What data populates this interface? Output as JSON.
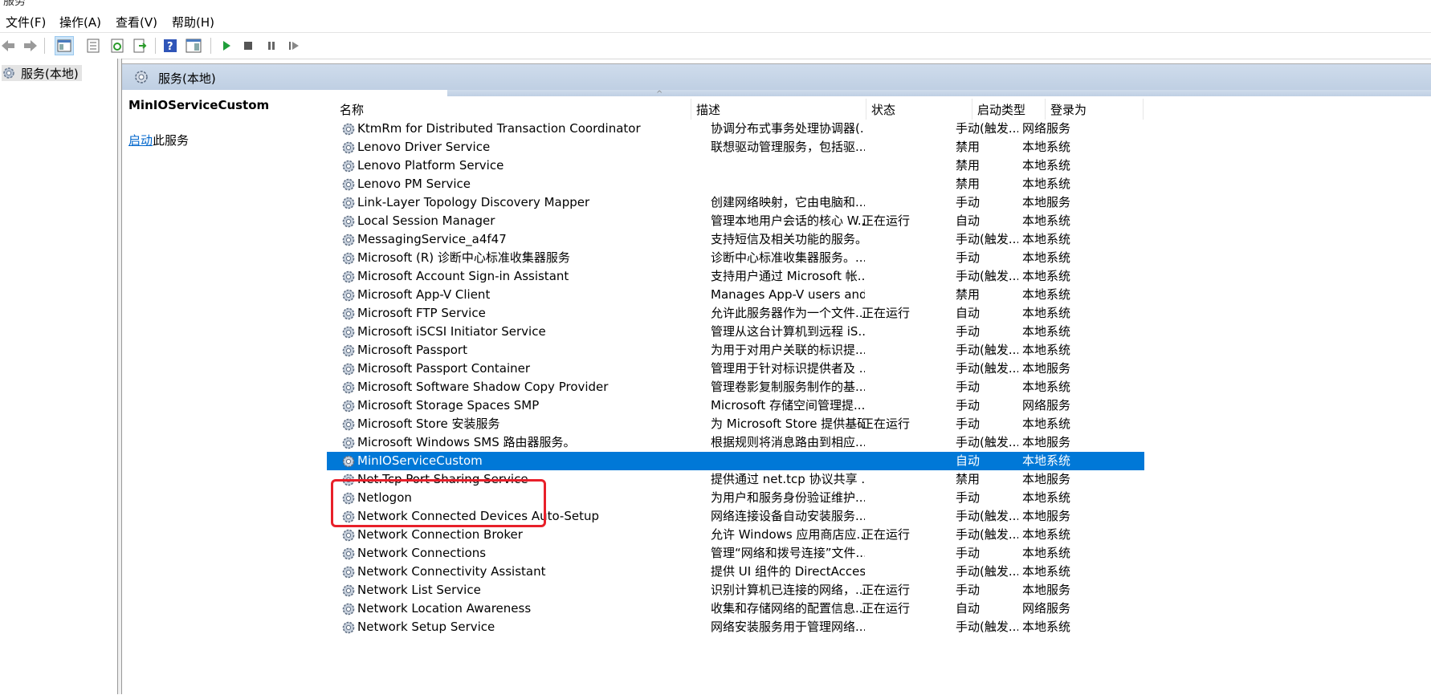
{
  "window": {
    "title": "服务"
  },
  "menu": [
    "文件(F)",
    "操作(A)",
    "查看(V)",
    "帮助(H)"
  ],
  "toolbar": [
    {
      "name": "back-icon"
    },
    {
      "name": "forward-icon"
    },
    {
      "name": "show-hide-tree-icon"
    },
    {
      "name": "properties-icon"
    },
    {
      "name": "refresh-icon"
    },
    {
      "name": "export-list-icon"
    },
    {
      "name": "help-icon"
    },
    {
      "name": "show-hide-action-pane-icon"
    },
    {
      "name": "start-service-icon"
    },
    {
      "name": "stop-service-icon"
    },
    {
      "name": "pause-service-icon"
    },
    {
      "name": "restart-service-icon"
    }
  ],
  "tree": {
    "root_label": "服务(本地)"
  },
  "pane": {
    "header": "服务(本地)"
  },
  "description_pane": {
    "service_name": "MinIOServiceCustom",
    "action_link": "启动",
    "action_suffix": "此服务"
  },
  "columns": {
    "name": "名称",
    "description": "描述",
    "status": "状态",
    "startup_type": "启动类型",
    "logon_as": "登录为"
  },
  "services": [
    {
      "name": "KtmRm for Distributed Transaction Coordinator",
      "description": "协调分布式事务处理协调器(...",
      "status": "",
      "startup": "手动(触发...",
      "logon": "网络服务"
    },
    {
      "name": "Lenovo Driver Service",
      "description": "联想驱动管理服务，包括驱...",
      "status": "",
      "startup": "禁用",
      "logon": "本地系统"
    },
    {
      "name": "Lenovo Platform Service",
      "description": "",
      "status": "",
      "startup": "禁用",
      "logon": "本地系统"
    },
    {
      "name": "Lenovo PM Service",
      "description": "",
      "status": "",
      "startup": "禁用",
      "logon": "本地系统"
    },
    {
      "name": "Link-Layer Topology Discovery Mapper",
      "description": "创建网络映射，它由电脑和...",
      "status": "",
      "startup": "手动",
      "logon": "本地服务"
    },
    {
      "name": "Local Session Manager",
      "description": "管理本地用户会话的核心 W...",
      "status": "正在运行",
      "startup": "自动",
      "logon": "本地系统"
    },
    {
      "name": "MessagingService_a4f47",
      "description": "支持短信及相关功能的服务。",
      "status": "",
      "startup": "手动(触发...",
      "logon": "本地系统"
    },
    {
      "name": "Microsoft (R) 诊断中心标准收集器服务",
      "description": "诊断中心标准收集器服务。...",
      "status": "",
      "startup": "手动",
      "logon": "本地系统"
    },
    {
      "name": "Microsoft Account Sign-in Assistant",
      "description": "支持用户通过 Microsoft 帐...",
      "status": "",
      "startup": "手动(触发...",
      "logon": "本地系统"
    },
    {
      "name": "Microsoft App-V Client",
      "description": "Manages App-V users and ...",
      "status": "",
      "startup": "禁用",
      "logon": "本地系统"
    },
    {
      "name": "Microsoft FTP Service",
      "description": "允许此服务器作为一个文件...",
      "status": "正在运行",
      "startup": "自动",
      "logon": "本地系统"
    },
    {
      "name": "Microsoft iSCSI Initiator Service",
      "description": "管理从这台计算机到远程 iS...",
      "status": "",
      "startup": "手动",
      "logon": "本地系统"
    },
    {
      "name": "Microsoft Passport",
      "description": "为用于对用户关联的标识提...",
      "status": "",
      "startup": "手动(触发...",
      "logon": "本地系统"
    },
    {
      "name": "Microsoft Passport Container",
      "description": "管理用于针对标识提供者及 ...",
      "status": "",
      "startup": "手动(触发...",
      "logon": "本地服务"
    },
    {
      "name": "Microsoft Software Shadow Copy Provider",
      "description": "管理卷影复制服务制作的基...",
      "status": "",
      "startup": "手动",
      "logon": "本地系统"
    },
    {
      "name": "Microsoft Storage Spaces SMP",
      "description": "Microsoft 存储空间管理提...",
      "status": "",
      "startup": "手动",
      "logon": "网络服务"
    },
    {
      "name": "Microsoft Store 安装服务",
      "description": "为 Microsoft Store 提供基础...",
      "status": "正在运行",
      "startup": "手动",
      "logon": "本地系统"
    },
    {
      "name": "Microsoft Windows SMS 路由器服务。",
      "description": "根据规则将消息路由到相应...",
      "status": "",
      "startup": "手动(触发...",
      "logon": "本地服务"
    },
    {
      "name": "MinIOServiceCustom",
      "description": "",
      "status": "",
      "startup": "自动",
      "logon": "本地系统",
      "selected": true
    },
    {
      "name": "Net.Tcp Port Sharing Service",
      "description": "提供通过 net.tcp 协议共享 ...",
      "status": "",
      "startup": "禁用",
      "logon": "本地服务"
    },
    {
      "name": "Netlogon",
      "description": "为用户和服务身份验证维护...",
      "status": "",
      "startup": "手动",
      "logon": "本地系统"
    },
    {
      "name": "Network Connected Devices Auto-Setup",
      "description": "网络连接设备自动安装服务...",
      "status": "",
      "startup": "手动(触发...",
      "logon": "本地服务"
    },
    {
      "name": "Network Connection Broker",
      "description": "允许 Windows 应用商店应...",
      "status": "正在运行",
      "startup": "手动(触发...",
      "logon": "本地系统"
    },
    {
      "name": "Network Connections",
      "description": "管理“网络和拨号连接”文件...",
      "status": "",
      "startup": "手动",
      "logon": "本地系统"
    },
    {
      "name": "Network Connectivity Assistant",
      "description": "提供 UI 组件的 DirectAcces...",
      "status": "",
      "startup": "手动(触发...",
      "logon": "本地系统"
    },
    {
      "name": "Network List Service",
      "description": "识别计算机已连接的网络，...",
      "status": "正在运行",
      "startup": "手动",
      "logon": "本地服务"
    },
    {
      "name": "Network Location Awareness",
      "description": "收集和存储网络的配置信息...",
      "status": "正在运行",
      "startup": "自动",
      "logon": "网络服务"
    },
    {
      "name": "Network Setup Service",
      "description": "网络安装服务用于管理网络...",
      "status": "",
      "startup": "手动(触发...",
      "logon": "本地系统"
    }
  ],
  "colors": {
    "selection": "#0078d7",
    "highlight_box": "#e8202a",
    "pane_header": "#c6d5e8"
  }
}
